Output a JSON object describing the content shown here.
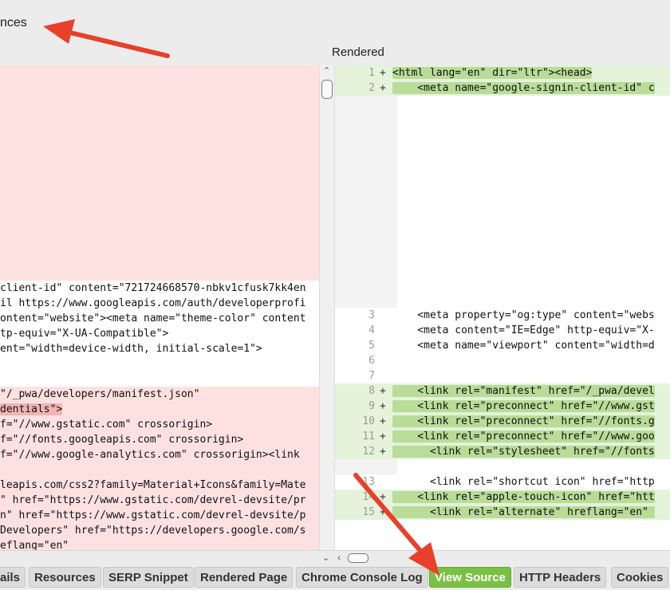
{
  "header": {
    "title_fragment": "nces",
    "right_pane_label": "Rendered"
  },
  "left_lines": [
    {
      "text": "client-id\" content=\"721724668570-nbkv1cfusk7kk4en",
      "style": "plain"
    },
    {
      "text": "il https://www.googleapis.com/auth/developerprofi",
      "style": "plain"
    },
    {
      "text": "ontent=\"website\"><meta name=\"theme-color\" content",
      "style": "plain"
    },
    {
      "text": "tp-equiv=\"X-UA-Compatible\">",
      "style": "plain"
    },
    {
      "text": "ent=\"width=device-width, initial-scale=1\">",
      "style": "plain"
    },
    {
      "text": "\"/_pwa/developers/manifest.json\"",
      "style": "removed"
    },
    {
      "text": "dentials\">",
      "style": "removed"
    },
    {
      "text": "f=\"//www.gstatic.com\" crossorigin>",
      "style": "removed"
    },
    {
      "text": "f=\"//fonts.googleapis.com\" crossorigin>",
      "style": "removed"
    },
    {
      "text": "f=\"//www.google-analytics.com\" crossorigin><link",
      "style": "removed"
    },
    {
      "text": "leapis.com/css2?family=Material+Icons&family=Mate",
      "style": "removed"
    },
    {
      "text": "\" href=\"https://www.gstatic.com/devrel-devsite/pr",
      "style": "removed"
    },
    {
      "text": "n\" href=\"https://www.gstatic.com/devrel-devsite/p",
      "style": "removed"
    },
    {
      "text": "Developers\" href=\"https://developers.google.com/s",
      "style": "removed"
    },
    {
      "text": "eflang=\"en\"",
      "style": "removed"
    }
  ],
  "right_lines": [
    {
      "num": "1",
      "marker": "+",
      "text": "<html lang=\"en\" dir=\"ltr\"><head>",
      "style": "added"
    },
    {
      "num": "2",
      "marker": "+",
      "text": "    <meta name=\"google-signin-client-id\" c",
      "style": "added"
    },
    {
      "num": "3",
      "marker": "",
      "text": "    <meta property=\"og:type\" content=\"webs",
      "style": "plain"
    },
    {
      "num": "4",
      "marker": "",
      "text": "    <meta content=\"IE=Edge\" http-equiv=\"X-",
      "style": "plain"
    },
    {
      "num": "5",
      "marker": "",
      "text": "    <meta name=\"viewport\" content=\"width=d",
      "style": "plain"
    },
    {
      "num": "6",
      "marker": "",
      "text": "",
      "style": "plain"
    },
    {
      "num": "7",
      "marker": "",
      "text": "",
      "style": "plain"
    },
    {
      "num": "8",
      "marker": "+",
      "text": "    <link rel=\"manifest\" href=\"/_pwa/devel",
      "style": "added"
    },
    {
      "num": "9",
      "marker": "+",
      "text": "    <link rel=\"preconnect\" href=\"//www.gst",
      "style": "added"
    },
    {
      "num": "10",
      "marker": "+",
      "text": "    <link rel=\"preconnect\" href=\"//fonts.g",
      "style": "added"
    },
    {
      "num": "11",
      "marker": "+",
      "text": "    <link rel=\"preconnect\" href=\"//www.goo",
      "style": "added"
    },
    {
      "num": "12",
      "marker": "+",
      "text": "      <link rel=\"stylesheet\" href=\"//fonts",
      "style": "added"
    },
    {
      "num": "13",
      "marker": "",
      "text": "      <link rel=\"shortcut icon\" href=\"http",
      "style": "plain"
    },
    {
      "num": "14",
      "marker": "+",
      "text": "    <link rel=\"apple-touch-icon\" href=\"htt",
      "style": "added"
    },
    {
      "num": "15",
      "marker": "+",
      "text": "      <link rel=\"alternate\" hreflang=\"en\" ",
      "style": "added"
    }
  ],
  "tabs": [
    {
      "label": "ails",
      "active": false
    },
    {
      "label": "Resources",
      "active": false
    },
    {
      "label": "SERP Snippet",
      "active": false
    },
    {
      "label": "Rendered Page",
      "active": false
    },
    {
      "label": "Chrome Console Log",
      "active": false
    },
    {
      "label": "View Source",
      "active": true
    },
    {
      "label": "HTTP Headers",
      "active": false
    },
    {
      "label": "Cookies",
      "active": false
    }
  ],
  "colors": {
    "active_tab": "#7ac143",
    "removed_bg": "#fde1e1",
    "added_bg": "#e4f3da",
    "arrow": "#e8402a"
  },
  "icons": {
    "scroll_up": "chevron-up-icon",
    "scroll_down": "chevron-down-icon",
    "scroll_left": "chevron-left-icon",
    "annotation": "arrow-icon"
  }
}
